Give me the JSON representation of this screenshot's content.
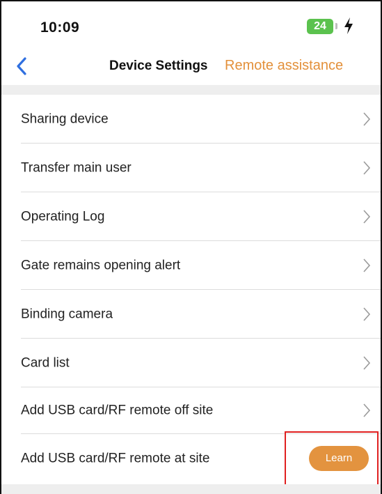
{
  "status_bar": {
    "time": "10:09",
    "battery_level": "24",
    "battery_color": "#5bc24e",
    "charging_icon": "lightning-bolt-icon"
  },
  "nav": {
    "back_icon": "chevron-left-icon",
    "title": "Device Settings",
    "action_label": "Remote assistance",
    "accent_color": "#e3903a"
  },
  "menu": {
    "items": [
      {
        "label": "Sharing device",
        "trailing": "chevron-right-icon"
      },
      {
        "label": "Transfer main user",
        "trailing": "chevron-right-icon"
      },
      {
        "label": "Operating Log",
        "trailing": "chevron-right-icon"
      },
      {
        "label": "Gate remains opening alert",
        "trailing": "chevron-right-icon"
      },
      {
        "label": "Binding camera",
        "trailing": "chevron-right-icon"
      },
      {
        "label": "Card list",
        "trailing": "chevron-right-icon"
      },
      {
        "label": "Add USB card/RF remote off site",
        "trailing": "chevron-right-icon"
      },
      {
        "label": "Add USB card/RF remote at site",
        "trailing": "learn-button"
      }
    ],
    "learn_label": "Learn"
  },
  "annotation": {
    "highlight_color": "#e02020"
  }
}
